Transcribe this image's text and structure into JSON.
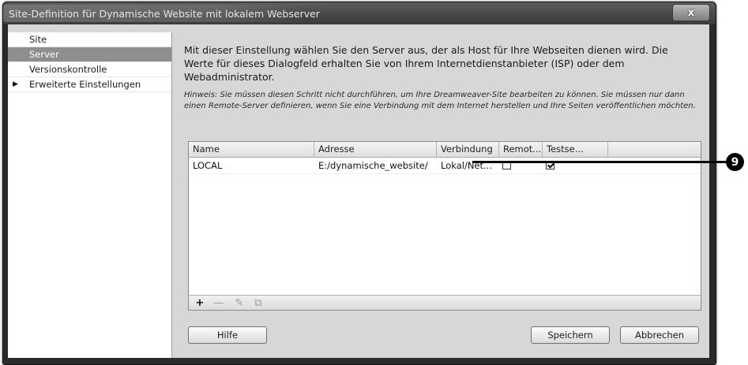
{
  "window": {
    "title": "Site-Definition für Dynamische Website mit lokalem Webserver",
    "close_label": "x"
  },
  "sidebar": {
    "items": [
      {
        "label": "Site",
        "selected": false,
        "expandable": false
      },
      {
        "label": "Server",
        "selected": true,
        "expandable": false
      },
      {
        "label": "Versionskontrolle",
        "selected": false,
        "expandable": false
      },
      {
        "label": "Erweiterte Einstellungen",
        "selected": false,
        "expandable": true
      }
    ],
    "expand_glyph": "▶"
  },
  "main": {
    "description": "Mit dieser Einstellung wählen Sie den Server aus, der als Host für Ihre Webseiten dienen wird. Die Werte für dieses Dialogfeld erhalten Sie von Ihrem Internetdienstanbieter (ISP) oder dem Webadministrator.",
    "hint": "Hinweis: Sie müssen diesen Schritt nicht durchführen, um Ihre Dreamweaver-Site bearbeiten zu können. Sie müssen nur dann einen Remote-Server definieren, wenn Sie eine Verbindung mit dem Internet herstellen und Ihre Seiten veröffentlichen möchten."
  },
  "server_table": {
    "columns": [
      "Name",
      "Adresse",
      "Verbindung",
      "Remot...",
      "Testse..."
    ],
    "rows": [
      {
        "name": "LOCAL",
        "address": "E:/dynamische_website/",
        "connection": "Lokal/Net...",
        "remote": false,
        "testserver": true
      }
    ],
    "toolbar": {
      "add": "+",
      "remove": "—",
      "edit": "✎",
      "duplicate": "⧉"
    }
  },
  "buttons": {
    "help": "Hilfe",
    "save": "Speichern",
    "cancel": "Abbrechen"
  },
  "callout": {
    "number": "9"
  }
}
